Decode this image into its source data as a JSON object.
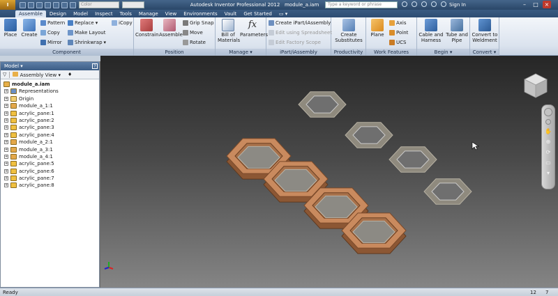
{
  "titlebar": {
    "logo": "I",
    "app_title": "Autodesk Inventor Professional 2012",
    "file_name": "module_a.iam",
    "color_select": "Color",
    "search_placeholder": "Type a keyword or phrase",
    "sign_in": "Sign In",
    "minimize": "–",
    "maximize": "□",
    "close": "×"
  },
  "tabs": [
    "Assemble",
    "Design",
    "Model",
    "Inspect",
    "Tools",
    "Manage",
    "View",
    "Environments",
    "Vault",
    "Get Started"
  ],
  "active_tab": "Assemble",
  "ribbon": {
    "component": {
      "label": "Component",
      "place": "Place",
      "create": "Create",
      "pattern": "Pattern",
      "copy": "Copy",
      "mirror": "Mirror",
      "replace": "Replace",
      "make_layout": "Make Layout",
      "shrinkwrap": "Shrinkwrap",
      "icopy": "iCopy"
    },
    "position": {
      "label": "Position",
      "constrain": "Constrain",
      "assemble": "Assemble",
      "grip_snap": "Grip Snap",
      "move": "Move",
      "rotate": "Rotate"
    },
    "manage": {
      "label": "Manage",
      "bom_line1": "Bill of",
      "bom_line2": "Materials",
      "parameters": "Parameters",
      "fx": "fx"
    },
    "ipart": {
      "label": "iPart/iAssembly",
      "create": "Create iPart/iAssembly",
      "edit_spreadsheet": "Edit using Spreadsheet",
      "edit_factory": "Edit Factory Scope"
    },
    "productivity": {
      "label": "Productivity",
      "line1": "Create",
      "line2": "Substitutes"
    },
    "work_features": {
      "label": "Work Features",
      "plane": "Plane",
      "axis": "Axis",
      "point": "Point",
      "ucs": "UCS"
    },
    "begin": {
      "label": "Begin",
      "cable_1": "Cable and",
      "cable_2": "Harness",
      "tube_1": "Tube and",
      "tube_2": "Pipe"
    },
    "convert": {
      "label": "Convert",
      "line1": "Convert to",
      "line2": "Weldment"
    }
  },
  "browser": {
    "title": "Model",
    "help": "?",
    "view_label": "Assembly View",
    "root": "module_a.iam",
    "items": [
      "Representations",
      "Origin",
      "module_a_1:1",
      "acrylic_pane:1",
      "acrylic_pane:2",
      "acrylic_pane:3",
      "acrylic_pane:4",
      "module_a_2:1",
      "module_a_3:1",
      "module_a_4:1",
      "acrylic_pane:5",
      "acrylic_pane:6",
      "acrylic_pane:7",
      "acrylic_pane:8"
    ]
  },
  "status": {
    "text": "Ready",
    "num1": "12",
    "num2": "7"
  },
  "colors": {
    "wood": "#c98a5e",
    "acrylic": "#8c8a84",
    "ribbon_blue": "#2d4c72"
  }
}
